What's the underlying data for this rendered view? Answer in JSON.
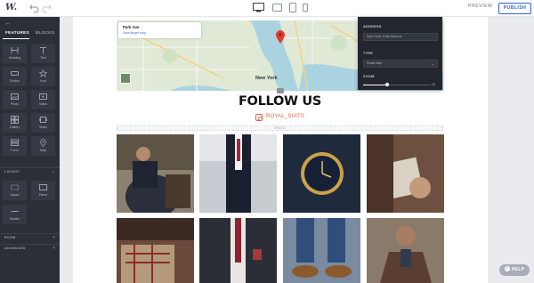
{
  "topbar": {
    "logo": "W.",
    "preview_label": "PREVIEW",
    "publish_label": "PUBLISH",
    "devices": [
      "desktop-icon",
      "tablet-landscape-icon",
      "tablet-portrait-icon",
      "mobile-icon"
    ]
  },
  "sidebar": {
    "tabs": [
      "FEATURES",
      "BLOCKS"
    ],
    "elements": [
      "Heading",
      "Text",
      "Button",
      "Icon",
      "Photo",
      "Video",
      "Gallery",
      "Slider",
      "Form",
      "Map"
    ],
    "layout_header": "LAYOUT",
    "layout_items": [
      "Space",
      "Panel",
      "Divider"
    ],
    "ecom_header": "ECOM",
    "advanced_header": "ADVANCED"
  },
  "map": {
    "place_title": "Park Ave",
    "place_link": "View larger map",
    "city_label": "New York"
  },
  "panel": {
    "address_label": "ADDRESS",
    "address_value": "New York, Park Avenue",
    "type_label": "TYPE",
    "type_value": "Road Map",
    "zoom_label": "ZOOM",
    "zoom_value": "10",
    "zoom_fraction": 0.36
  },
  "content": {
    "heading": "FOLLOW US",
    "instagram_handle": "ROYAL_SUITS",
    "space_label": "SPACE"
  },
  "help_label": "HELP"
}
